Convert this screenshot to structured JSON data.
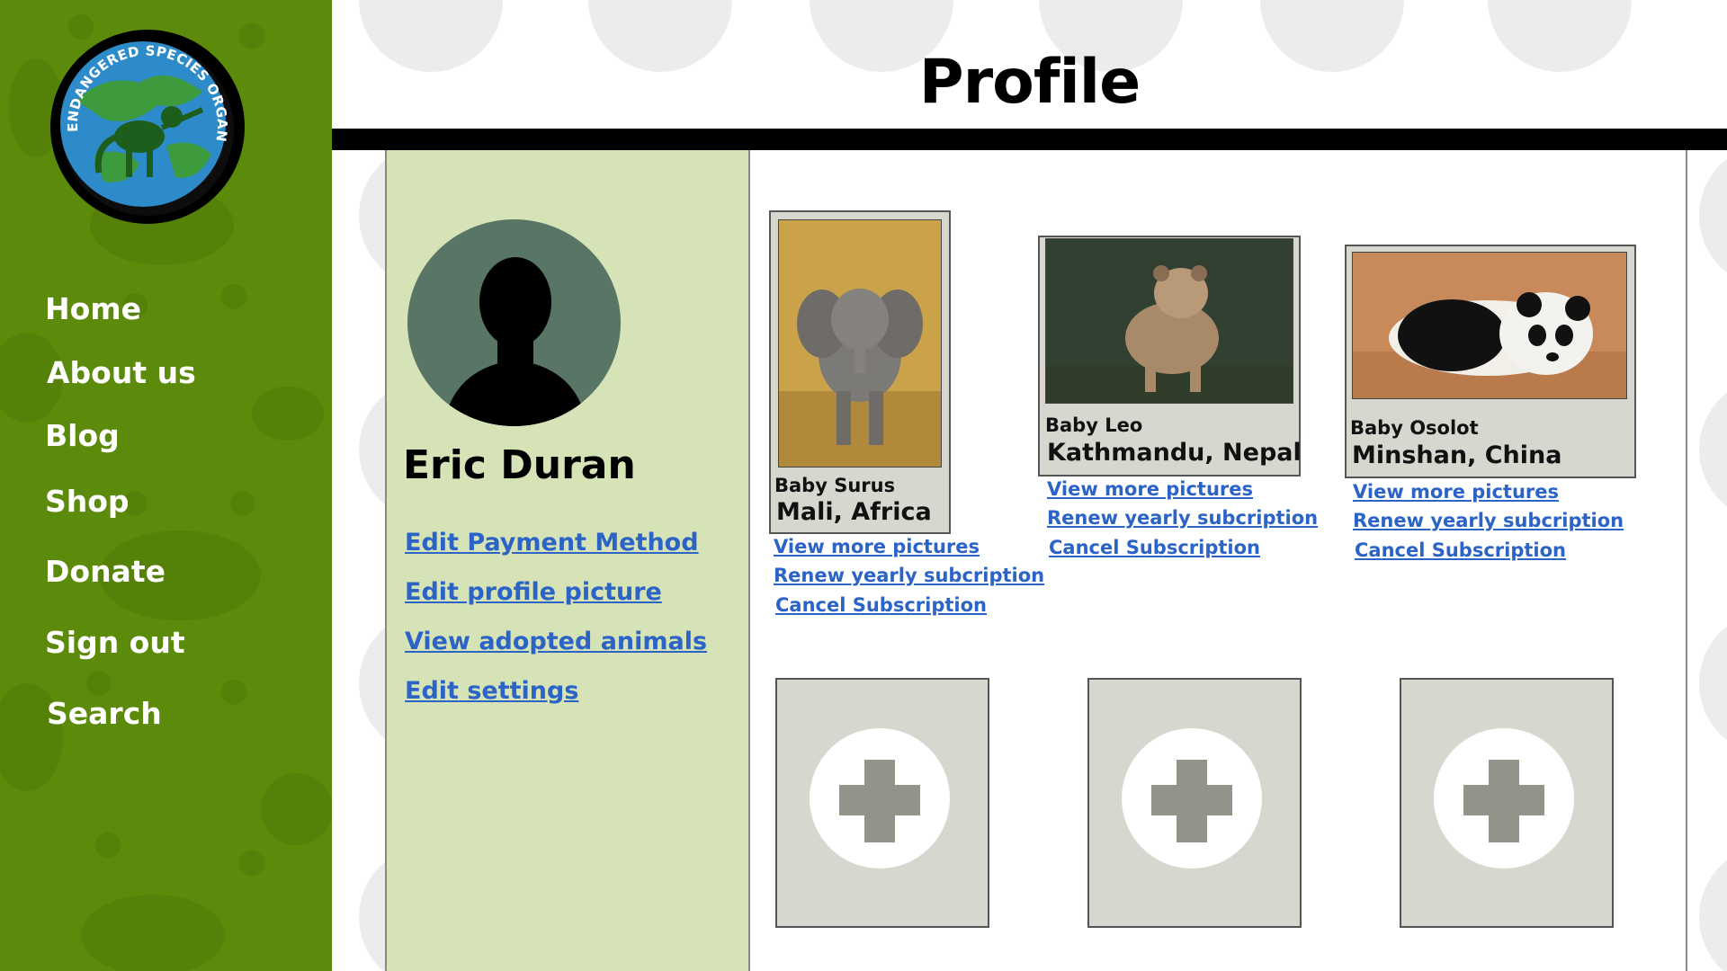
{
  "page": {
    "title": "Profile"
  },
  "logo": {
    "text": "ENDANGERED SPECIES ORGANIZATION",
    "icon": "monkey-globe-logo"
  },
  "nav": {
    "items": [
      {
        "label": "Home"
      },
      {
        "label": "About us"
      },
      {
        "label": "Blog"
      },
      {
        "label": "Shop"
      },
      {
        "label": "Donate"
      },
      {
        "label": "Sign out"
      },
      {
        "label": "Search"
      }
    ]
  },
  "profile": {
    "name": "Eric Duran",
    "avatar_icon": "person-silhouette-icon",
    "links": [
      {
        "label": "Edit Payment Method"
      },
      {
        "label": "Edit profile picture"
      },
      {
        "label": "View adopted animals"
      },
      {
        "label": "Edit settings"
      }
    ]
  },
  "adopted": [
    {
      "name": "Baby Surus",
      "location": "Mali, Africa",
      "photo": "baby-elephant",
      "links": [
        "View more pictures",
        "Renew yearly subcription",
        "Cancel Subscription"
      ]
    },
    {
      "name": "Baby Leo",
      "location": "Kathmandu, Nepal",
      "photo": "tiger-cub",
      "links": [
        "View more pictures",
        "Renew yearly subcription",
        "Cancel Subscription"
      ]
    },
    {
      "name": "Baby Osolot",
      "location": "Minshan, China",
      "photo": "panda-cub",
      "links": [
        "View more pictures",
        "Renew yearly subcription",
        "Cancel Subscription"
      ]
    }
  ],
  "add_slots": [
    {
      "icon": "plus-icon"
    },
    {
      "icon": "plus-icon"
    },
    {
      "icon": "plus-icon"
    }
  ],
  "colors": {
    "sidebar": "#5c8a0a",
    "profile_panel": "#d5e3b7",
    "link": "#2b63c6",
    "card": "#d7d7cf"
  }
}
